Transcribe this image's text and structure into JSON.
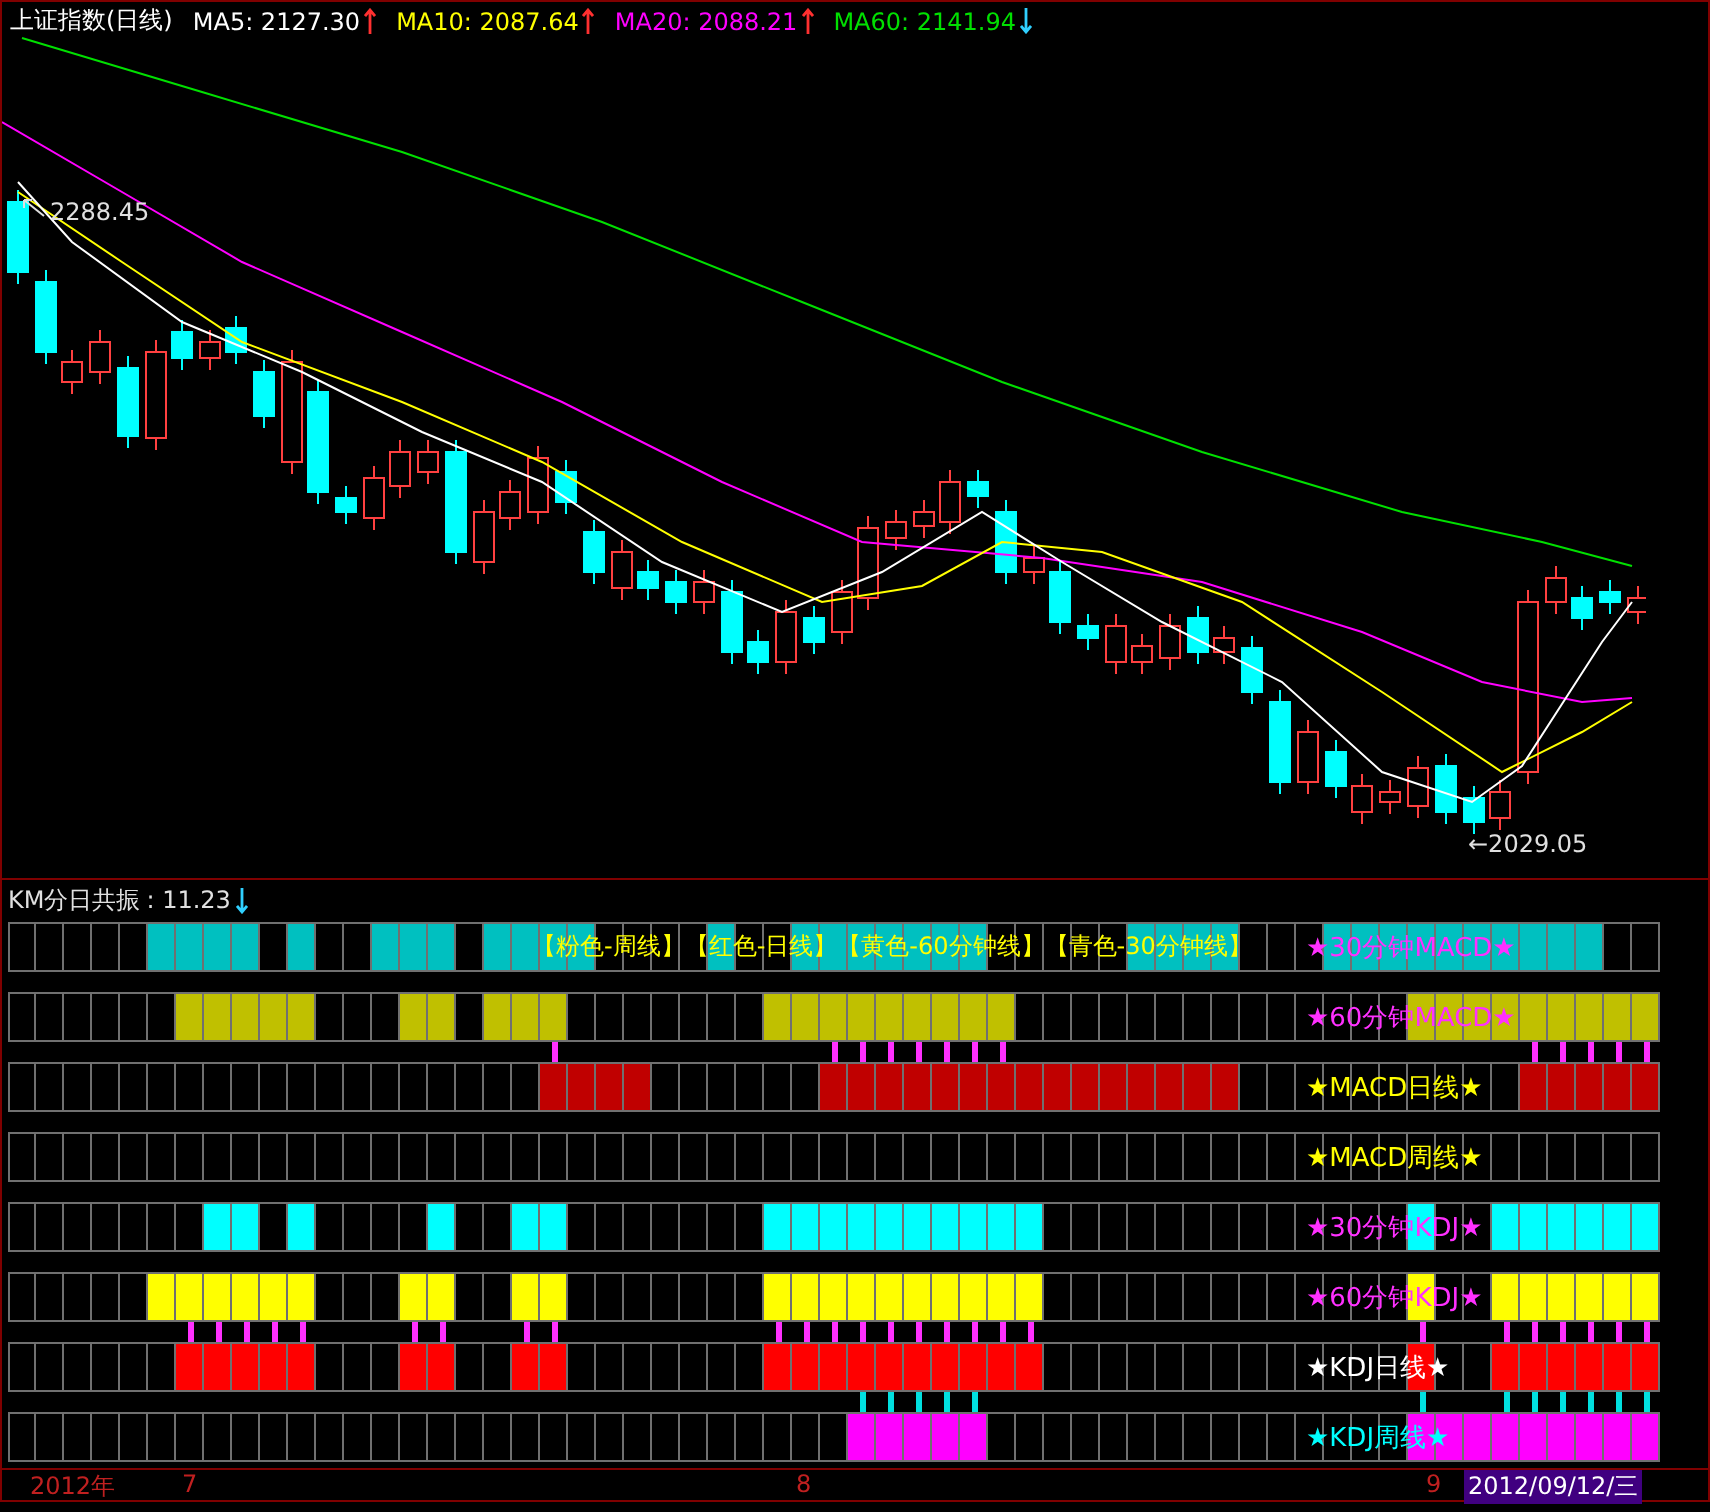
{
  "chart": {
    "title": "上证指数(日线)",
    "moving_averages": [
      {
        "label": "MA5: 2127.30",
        "color": "#ffffff",
        "rising": true
      },
      {
        "label": "MA10: 2087.64",
        "color": "#ffff00",
        "rising": true
      },
      {
        "label": "MA20: 2088.21",
        "color": "#ff00ff",
        "rising": true
      },
      {
        "label": "MA60: 2141.94",
        "color": "#00e000",
        "rising": false
      }
    ],
    "high_label": "2288.45",
    "low_label": "←2029.05"
  },
  "indicator": {
    "title": "KM分日共振",
    "value": ": 11.23",
    "rising": false,
    "legend": "【粉色-周线】【红色-日线】【黄色-60分钟线】【青色-30分钟线】",
    "rows": [
      {
        "label": "★30分钟MACD★",
        "color": "#00c0c0"
      },
      {
        "label": "★60分钟MACD★",
        "color": "#c0c000"
      },
      {
        "label": "★MACD日线★",
        "color": "#c00000"
      },
      {
        "label": "★MACD周线★"
      },
      {
        "label": "★30分钟KDJ★",
        "color": "#00ffff"
      },
      {
        "label": "★60分钟KDJ★",
        "color": "#ffff00"
      },
      {
        "label": "★KDJ日线★",
        "color": "#ff0000"
      },
      {
        "label": "★KDJ周线★",
        "color": "#ff00ff"
      }
    ]
  },
  "axis": {
    "labels": [
      "2012年",
      "7",
      "8",
      "9"
    ],
    "cursor_date": "2012/09/12/三"
  }
}
